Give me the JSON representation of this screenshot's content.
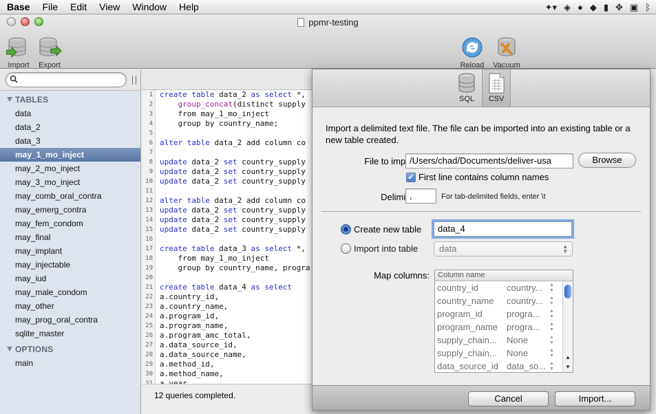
{
  "menubar": {
    "app": "Base",
    "items": [
      "File",
      "Edit",
      "View",
      "Window",
      "Help"
    ]
  },
  "window": {
    "title": "ppmr-testing",
    "toolbar": {
      "import": "Import",
      "export": "Export",
      "reload": "Reload",
      "vacuum": "Vacuum"
    }
  },
  "sidebar": {
    "tables_header": "TABLES",
    "tables": [
      "data",
      "data_2",
      "data_3",
      "may_1_mo_inject",
      "may_2_mo_inject",
      "may_3_mo_inject",
      "may_comb_oral_contra",
      "may_emerg_contra",
      "may_fem_condom",
      "may_final",
      "may_implant",
      "may_injectable",
      "may_iud",
      "may_male_condom",
      "may_other",
      "may_prog_oral_contra",
      "sqlite_master"
    ],
    "selected": "may_1_mo_inject",
    "options_header": "OPTIONS",
    "options": [
      "main"
    ]
  },
  "editor": {
    "line_numbers": [
      "1",
      "2",
      "3",
      "4",
      "5",
      "6",
      "7",
      "8",
      "9",
      "10",
      "11",
      "12",
      "13",
      "14",
      "15",
      "16",
      "17",
      "18",
      "19",
      "20",
      "21",
      "22",
      "23",
      "24",
      "25",
      "26",
      "27",
      "28",
      "29",
      "30",
      "31"
    ],
    "status": "12 queries completed."
  },
  "sheet": {
    "tabs": {
      "sql": "SQL",
      "csv": "CSV"
    },
    "description": "Import a delimited text file. The file can be imported into an existing table or a new table created.",
    "file_label": "File to import:",
    "file_value": "/Users/chad/Documents/deliver-usa",
    "browse": "Browse",
    "first_line_label": "First line contains column names",
    "delimiter_label": "Delimiter:",
    "delimiter_value": ",",
    "delimiter_hint": "For tab-delimited fields, enter \\t",
    "create_label": "Create new table",
    "create_value": "data_4",
    "import_into_label": "Import into table",
    "import_into_value": "data",
    "map_label": "Map columns:",
    "map_header": "Column name",
    "map_rows": [
      {
        "src": "country_id",
        "dst": "country..."
      },
      {
        "src": "country_name",
        "dst": "country..."
      },
      {
        "src": "program_id",
        "dst": "progra..."
      },
      {
        "src": "program_name",
        "dst": "progra..."
      },
      {
        "src": "supply_chain...",
        "dst": "None"
      },
      {
        "src": "supply_chain...",
        "dst": "None"
      },
      {
        "src": "data_source_id",
        "dst": "data_so..."
      }
    ],
    "cancel": "Cancel",
    "import": "Import..."
  }
}
